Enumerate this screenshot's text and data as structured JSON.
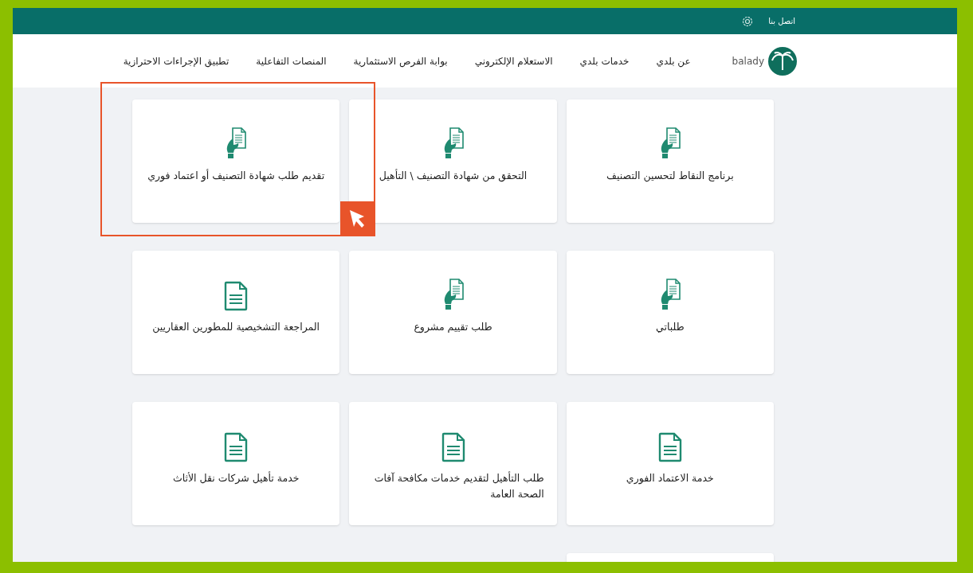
{
  "topbar": {
    "contact": "اتصل بنا"
  },
  "logo": {
    "text": "balady"
  },
  "nav": [
    "عن بلدي",
    "خدمات بلدي",
    "الاستعلام الإلكتروني",
    "بوابة الفرص الاستثمارية",
    "المنصات التفاعلية",
    "تطبيق الإجراءات الاحترازية"
  ],
  "cards": [
    {
      "title": "برنامج النقاط لتحسين التصنيف",
      "kind": "handheld",
      "highlighted": false
    },
    {
      "title": "التحقق من شهادة التصنيف \\ التأهيل",
      "kind": "handheld",
      "highlighted": false
    },
    {
      "title": "تقديم طلب شهادة التصنيف أو اعتماد فوري",
      "kind": "handheld",
      "highlighted": true
    },
    {
      "title": "طلباتي",
      "kind": "handheld",
      "highlighted": false
    },
    {
      "title": "طلب تقييم مشروع",
      "kind": "handheld",
      "highlighted": false
    },
    {
      "title": "المراجعة التشخيصية للمطورين العقاريين",
      "kind": "form",
      "highlighted": false
    },
    {
      "title": "خدمة الاعتماد الفوري",
      "kind": "form",
      "highlighted": false
    },
    {
      "title": "طلب التأهيل لتقديم خدمات مكافحة آفات الصحة العامة",
      "kind": "form",
      "highlighted": false
    },
    {
      "title": "خدمة تأهيل شركات نقل الأثاث",
      "kind": "form",
      "highlighted": false
    }
  ]
}
